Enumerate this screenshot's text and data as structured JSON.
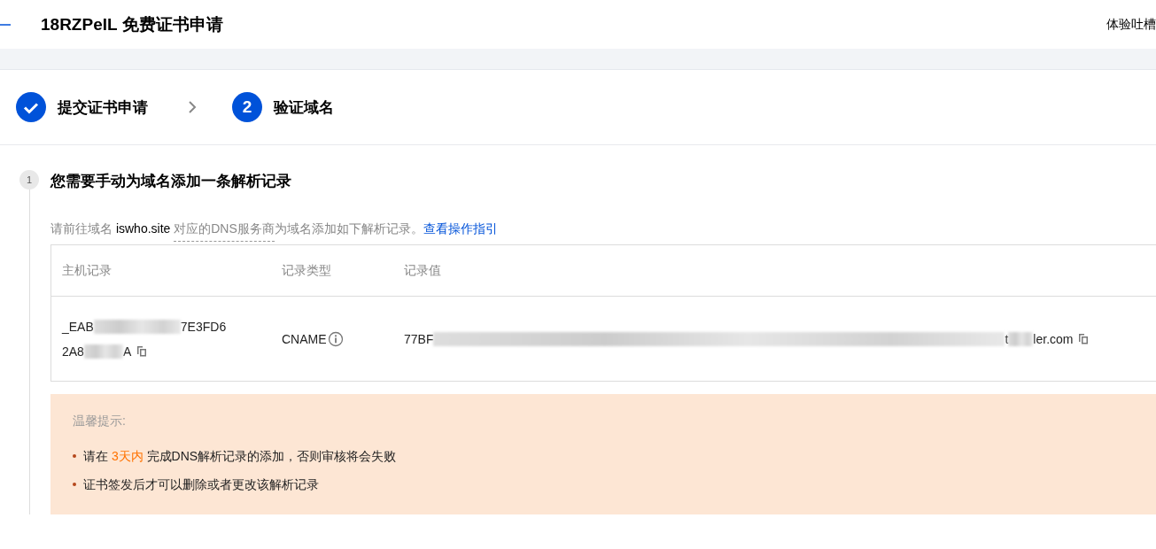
{
  "header": {
    "title": "18RZPeIL 免费证书申请",
    "feedback": "体验吐槽"
  },
  "steps": [
    {
      "completed": true,
      "label": "提交证书申请"
    },
    {
      "completed": false,
      "number": "2",
      "label": "验证域名"
    }
  ],
  "section": {
    "number": "1",
    "title": "您需要手动为域名添加一条解析记录",
    "description": {
      "prefix": "请前往域名 ",
      "domain": "iswho.site",
      "term": "对应的DNS服务商",
      "suffix": "为域名添加如下解析记录。",
      "link": "查看操作指引"
    },
    "table": {
      "columns": [
        "主机记录",
        "记录类型",
        "记录值"
      ],
      "row": {
        "host_record": {
          "line_1_start": "_EAB",
          "line_1_end": "7E3FD6",
          "line_2_start": "2A8",
          "line_2_end": "A"
        },
        "record_type": "CNAME",
        "record_value": {
          "start": "77BF",
          "middle": "t",
          "end": "ler.com"
        }
      }
    },
    "notice": {
      "title": "温馨提示:",
      "items": [
        {
          "before": "请在 ",
          "highlight": "3天内",
          "after": " 完成DNS解析记录的添加，否则审核将会失败"
        },
        {
          "before": "证书签发后才可以删除或者更改该解析记录"
        }
      ]
    }
  }
}
